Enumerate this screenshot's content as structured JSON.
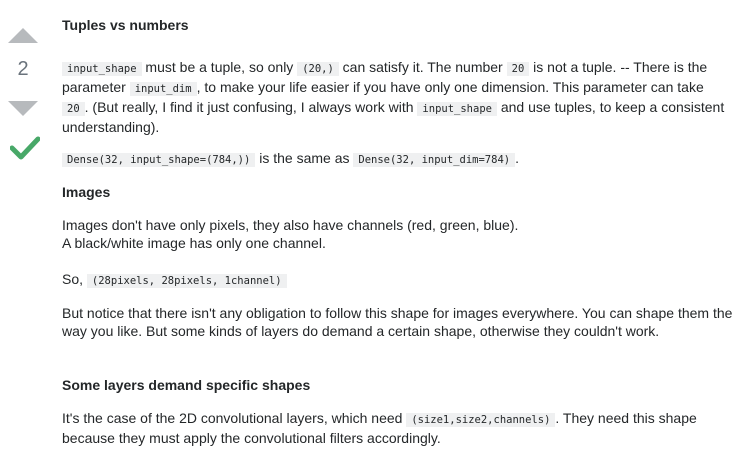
{
  "vote": {
    "count": "2"
  },
  "answer": {
    "h_tuples": "Tuples vs numbers",
    "p1": {
      "c1": "input_shape",
      "t1": " must be a tuple, so only ",
      "c2": "(20,)",
      "t2": " can satisfy it. The number ",
      "c3": "20",
      "t3": " is not a tuple. -- There is the parameter ",
      "c4": "input_dim",
      "t4": ", to make your life easier if you have only one dimension. This parameter can take ",
      "c5": "20",
      "t5": ". (But really, I find it just confusing, I always work with ",
      "c6": "input_shape",
      "t6": " and use tuples, to keep a consistent understanding)."
    },
    "p2": {
      "c1": "Dense(32, input_shape=(784,))",
      "t1": " is the same as ",
      "c2": "Dense(32, input_dim=784)",
      "t2": "."
    },
    "h_images": "Images",
    "p3": {
      "line1": "Images don't have only pixels, they also have channels (red, green, blue).",
      "line2": "A black/white image has only one channel."
    },
    "p4": {
      "t1": "So, ",
      "c1": "(28pixels, 28pixels, 1channel)"
    },
    "p5": "But notice that there isn't any obligation to follow this shape for images everywhere. You can shape them the way you like. But some kinds of layers do demand a certain shape, otherwise they couldn't work.",
    "h_layers": "Some layers demand specific shapes",
    "p6": {
      "t1": "It's the case of the 2D convolutional layers, which need ",
      "c1": "(size1,size2,channels)",
      "t2": ". They need this shape because they must apply the convolutional filters accordingly."
    }
  }
}
